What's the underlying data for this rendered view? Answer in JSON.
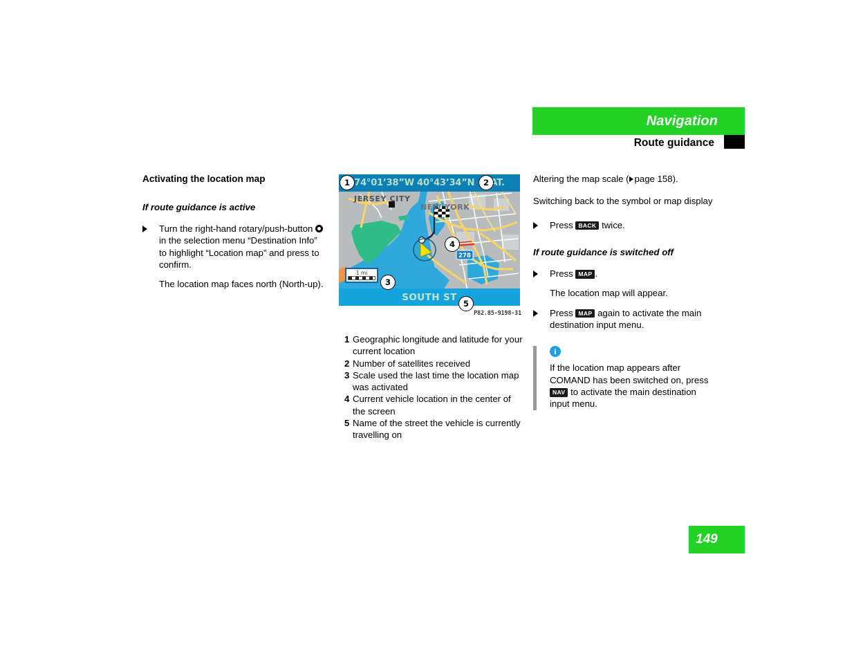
{
  "header": {
    "chapter": "Navigation",
    "section": "Route guidance"
  },
  "page_number": "149",
  "left_column": {
    "heading": "Activating the location map",
    "subheading": "If route guidance is active",
    "step_1_part_a": "Turn the right-hand rotary/push-button",
    "step_1_part_b": "in the selection menu “Destination Info” to highlight “Location map” and press to confirm.",
    "result": "The location map faces north (North-up)."
  },
  "figure": {
    "code": "P82.85-9198-31",
    "screen": {
      "coordinates": "74°01’38”W  40°43’34”N",
      "satellite_label": "SAT.",
      "city_label_left": "JERSEY CITY",
      "city_label_right": "NEW YORK",
      "scale_value": "1 mi",
      "street_name": "SOUTH ST",
      "highway_shield": "278"
    },
    "callouts": [
      "1",
      "2",
      "3",
      "4",
      "5"
    ],
    "legend": [
      {
        "num": "1",
        "text": "Geographic longitude and latitude for your current location"
      },
      {
        "num": "2",
        "text": "Number of satellites received"
      },
      {
        "num": "3",
        "text": "Scale used the last time the location map was activated"
      },
      {
        "num": "4",
        "text": "Current vehicle location in the center of the screen"
      },
      {
        "num": "5",
        "text": "Name of the street the vehicle is currently travelling on"
      }
    ]
  },
  "right_column": {
    "intro_before_ref": "Altering the map scale (",
    "intro_ref": "page 158",
    "intro_after_ref": ").",
    "heading_switch_back": "Switching back to the symbol or map display",
    "step_press_label": "Press",
    "key_back": "BACK",
    "step_back_after": "twice.",
    "heading_switched_off": "If route guidance is switched off",
    "key_map": "MAP",
    "step_map_after": ".",
    "result_map": "The location map will appear.",
    "step_map_again_after": "again to activate the main destination input menu.",
    "note": {
      "icon_char": "i",
      "text_before_key": "If the location map appears after COMAND has been switched on, press",
      "key_nav": "NAV",
      "text_after_key": "to activate the main destination input menu."
    }
  },
  "colors": {
    "brand_green": "#22D326",
    "info_blue": "#1CA1E2",
    "map_water": "#2FA9DC",
    "map_land": "#B9BCBD",
    "map_park": "#2FBC8A",
    "map_road": "#F5D36B"
  }
}
